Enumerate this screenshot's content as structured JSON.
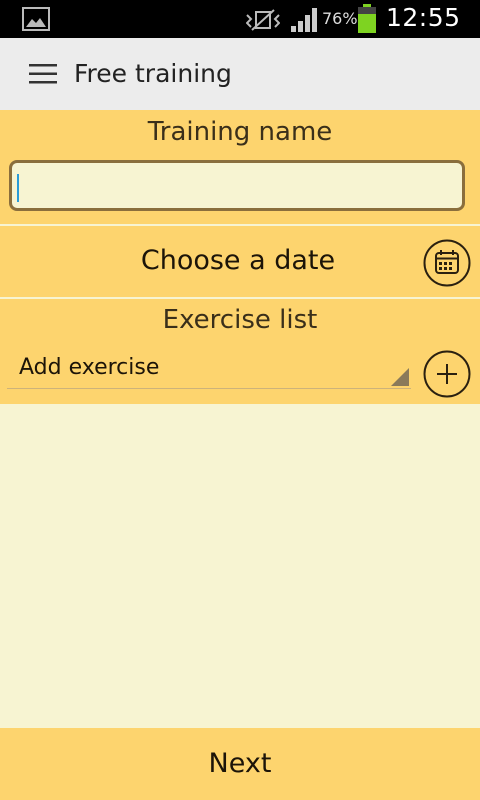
{
  "status_bar": {
    "battery_percent": "76%",
    "time": "12:55",
    "icons": [
      "gallery-icon",
      "vibrate-icon",
      "signal-icon",
      "battery-icon"
    ],
    "battery_color": "#7ed321"
  },
  "action_bar": {
    "title": "Free training",
    "menu_icon": "menu-icon"
  },
  "training_name": {
    "label": "Training name",
    "value": ""
  },
  "date": {
    "label": "Choose a date",
    "icon": "calendar-icon"
  },
  "exercise": {
    "label": "Exercise list",
    "selected": "Add exercise",
    "add_icon": "plus-icon"
  },
  "footer": {
    "next_label": "Next"
  },
  "colors": {
    "accent": "#fdd46e",
    "background": "#f7f4d2",
    "action_bar": "#ececec",
    "input_border": "#8a6e3c",
    "caret": "#2a9cd8"
  }
}
